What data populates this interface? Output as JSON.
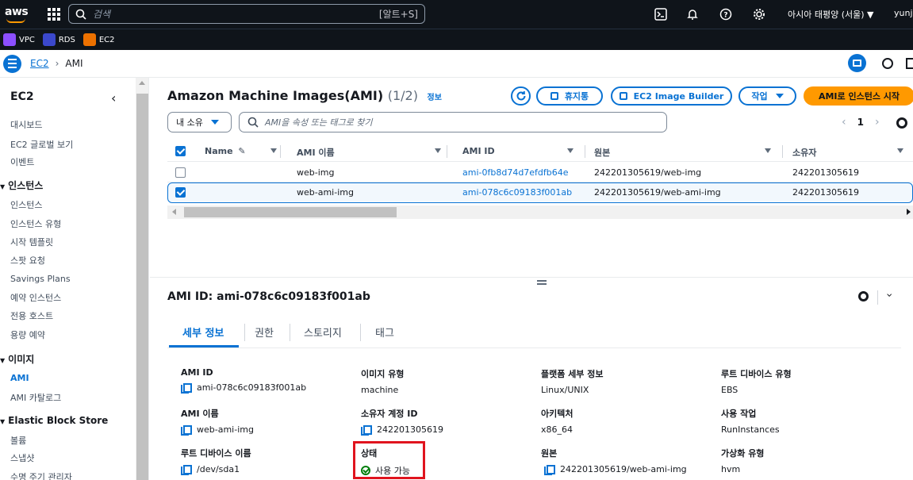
{
  "topnav": {
    "logo": "aws",
    "search_placeholder": "검색",
    "search_shortcut": "[알트+S]",
    "region": "아시아 태평양 (서울) ▼",
    "user": "yunji"
  },
  "favorites": [
    {
      "label": "VPC",
      "color": "#8c4fff"
    },
    {
      "label": "RDS",
      "color": "#3b48cc"
    },
    {
      "label": "EC2",
      "color": "#ed7100"
    }
  ],
  "breadcrumb": {
    "root": "EC2",
    "current": "AMI"
  },
  "sidebar": {
    "title": "EC2",
    "top_items": [
      "대시보드",
      "EC2 글로벌 보기",
      "이벤트"
    ],
    "sections": [
      {
        "title": "인스턴스",
        "items": [
          "인스턴스",
          "인스턴스 유형",
          "시작 템플릿",
          "스팟 요청",
          "Savings Plans",
          "예약 인스턴스",
          "전용 호스트",
          "용량 예약"
        ]
      },
      {
        "title": "이미지",
        "items": [
          "AMI",
          "AMI 카탈로그"
        ]
      },
      {
        "title": "Elastic Block Store",
        "items": [
          "볼륨",
          "스냅샷",
          "수명 주기 관리자"
        ]
      }
    ]
  },
  "header": {
    "title": "Amazon Machine Images(AMI)",
    "count": "(1/2)",
    "info": "정보",
    "buttons": {
      "recycle": "휴지통",
      "image_builder": "EC2 Image Builder",
      "actions": "작업",
      "launch": "AMI로 인스턴스 시작"
    }
  },
  "filter": {
    "owner": "내 소유",
    "placeholder": "AMI을 속성 또는 태그로 찾기",
    "page": "1",
    "prev": "‹",
    "next": "›"
  },
  "table": {
    "columns": [
      "Name",
      "AMI 이름",
      "AMI ID",
      "원본",
      "소유자"
    ],
    "rows": [
      {
        "name": "",
        "ami_name": "web-img",
        "ami_id": "ami-0fb8d74d7efdfb64e",
        "source": "242201305619/web-img",
        "owner": "242201305619",
        "selected": false
      },
      {
        "name": "",
        "ami_name": "web-ami-img",
        "ami_id": "ami-078c6c09183f001ab",
        "source": "242201305619/web-ami-img",
        "owner": "242201305619",
        "selected": true
      }
    ]
  },
  "detail": {
    "title": "AMI ID: ami-078c6c09183f001ab",
    "tabs": [
      "세부 정보",
      "권한",
      "스토리지",
      "태그"
    ],
    "fields": {
      "ami_id": {
        "k": "AMI ID",
        "v": "ami-078c6c09183f001ab"
      },
      "image_type": {
        "k": "이미지 유형",
        "v": "machine"
      },
      "platform": {
        "k": "플랫폼 세부 정보",
        "v": "Linux/UNIX"
      },
      "root_device_type": {
        "k": "루트 디바이스 유형",
        "v": "EBS"
      },
      "ami_name": {
        "k": "AMI 이름",
        "v": "web-ami-img"
      },
      "owner_account": {
        "k": "소유자 계정 ID",
        "v": "242201305619"
      },
      "architecture": {
        "k": "아키텍처",
        "v": "x86_64"
      },
      "usage_operation": {
        "k": "사용 작업",
        "v": "RunInstances"
      },
      "root_device_name": {
        "k": "루트 디바이스 이름",
        "v": "/dev/sda1"
      },
      "status": {
        "k": "상태",
        "v": "사용 가능"
      },
      "source": {
        "k": "원본",
        "v": "242201305619/web-ami-img"
      },
      "virtualization": {
        "k": "가상화 유형",
        "v": "hvm"
      }
    }
  }
}
